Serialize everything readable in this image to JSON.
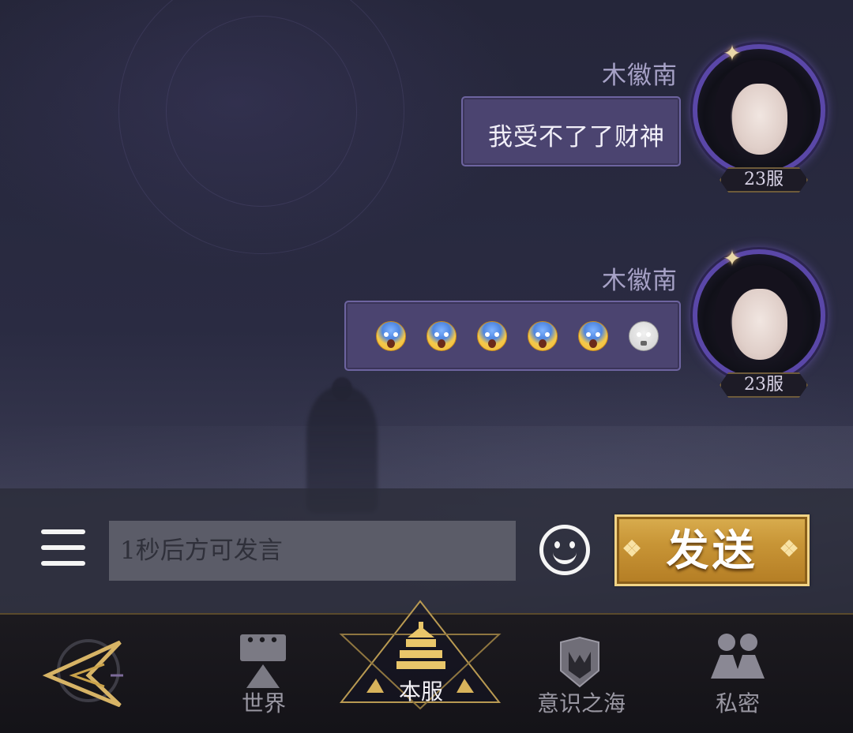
{
  "messages": [
    {
      "sender": "木徽南",
      "text": "我受不了了财神",
      "server_badge": "23服"
    },
    {
      "sender": "木徽南",
      "emojis": [
        "screaming-face",
        "screaming-face",
        "screaming-face",
        "screaming-face",
        "screaming-face",
        "skull-face"
      ],
      "server_badge": "23服"
    }
  ],
  "input": {
    "placeholder": "1秒后方可发言"
  },
  "send_button": {
    "label": "发送"
  },
  "nav": {
    "items": [
      {
        "label": "世界"
      },
      {
        "label": "本服"
      },
      {
        "label": "意识之海"
      },
      {
        "label": "私密"
      }
    ],
    "active_index": 1
  },
  "colors": {
    "bubble_bg": "#4b4470",
    "bubble_border": "#6d64a0",
    "send_gold": "#c89536",
    "sender_name": "#a7a2c7",
    "nav_bg": "#141318"
  },
  "icons": [
    "menu-icon",
    "emoji-icon",
    "game-logo-icon",
    "world-chat-icon",
    "server-chat-icon",
    "sea-of-consciousness-icon",
    "private-chat-icon"
  ]
}
